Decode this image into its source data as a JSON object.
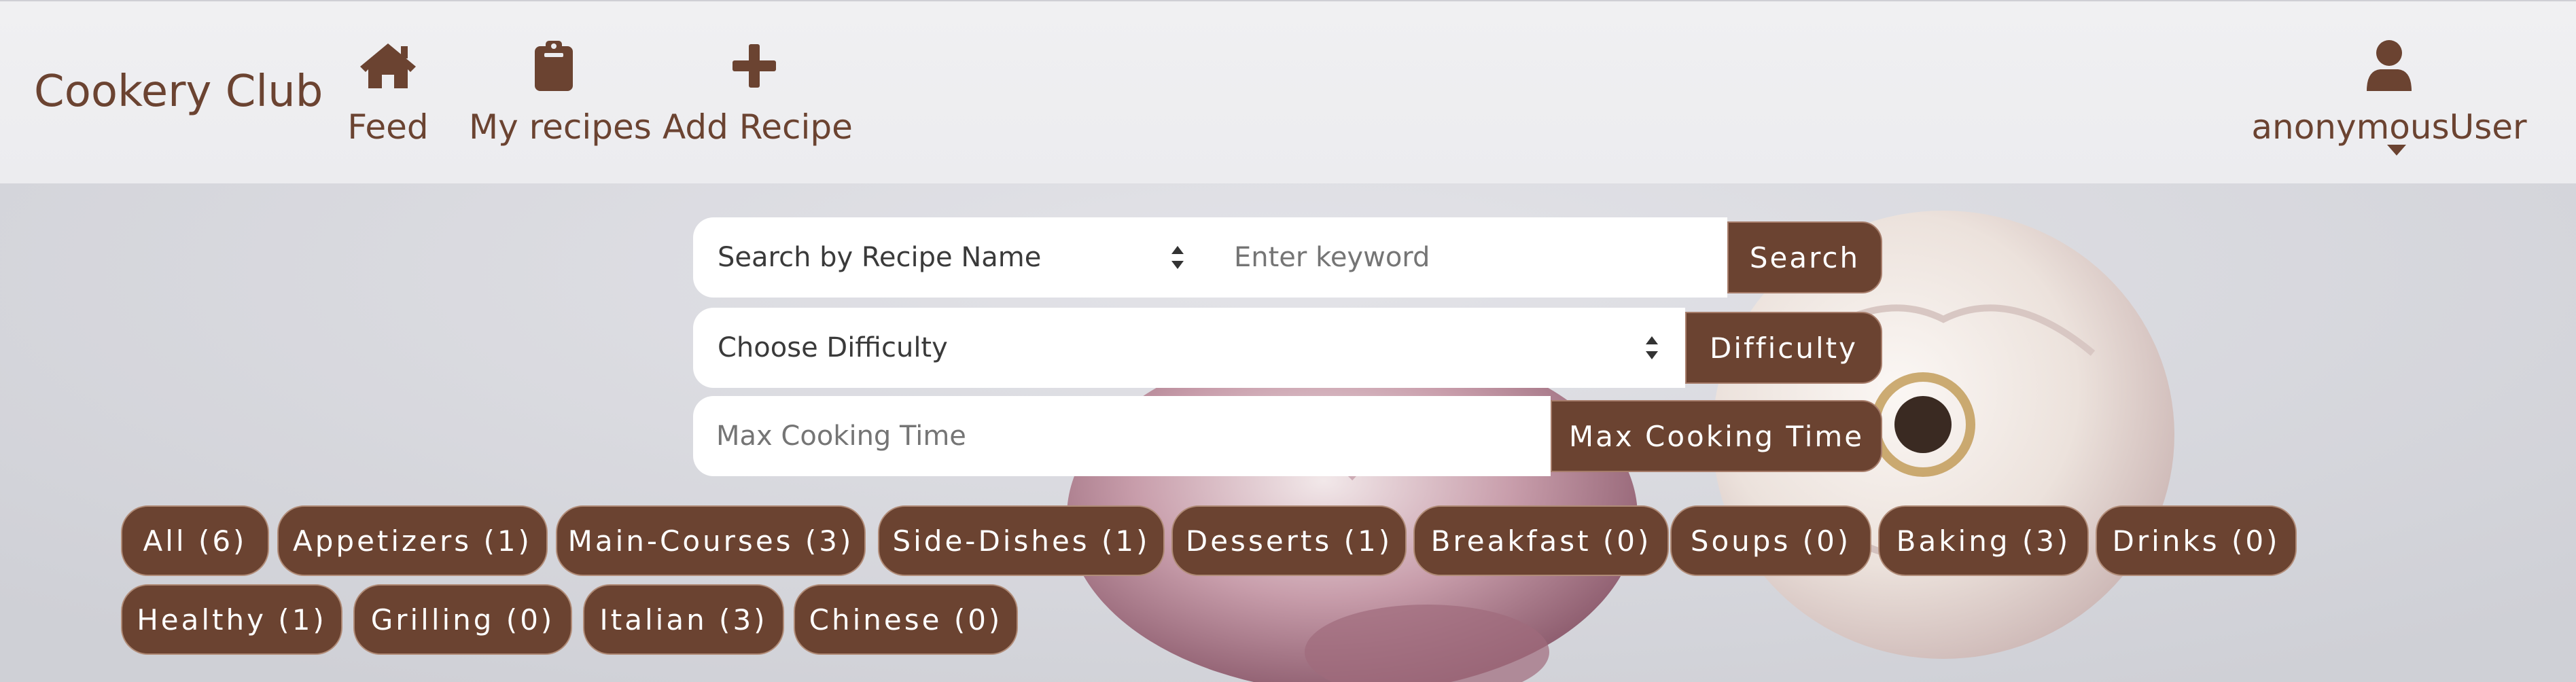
{
  "navbar": {
    "brand": "Cookery Club",
    "items": [
      {
        "label": "Feed",
        "icon": "home-icon"
      },
      {
        "label": "My recipes",
        "icon": "clipboard-icon"
      },
      {
        "label": "Add Recipe",
        "icon": "plus-icon"
      }
    ],
    "user": {
      "label": "anonymousUser",
      "icon": "user-icon"
    }
  },
  "search": {
    "mode_select": "Search by Recipe Name",
    "keyword_placeholder": "Enter keyword",
    "search_button": "Search",
    "difficulty_select": "Choose Difficulty",
    "difficulty_button": "Difficulty",
    "time_placeholder": "Max Cooking Time",
    "time_button": "Max Cooking Time"
  },
  "categories": [
    "All (6)",
    "Appetizers (1)",
    "Main-Courses (3)",
    "Side-Dishes (1)",
    "Desserts (1)",
    "Breakfast (0)",
    "Soups (0)",
    "Baking (3)",
    "Drinks (0)",
    "Healthy (1)",
    "Grilling (0)",
    "Italian (3)",
    "Chinese (0)"
  ],
  "colors": {
    "brand": "#6b4331",
    "navbar_bg": "#ececef",
    "page_bg": "#d8d9de"
  }
}
